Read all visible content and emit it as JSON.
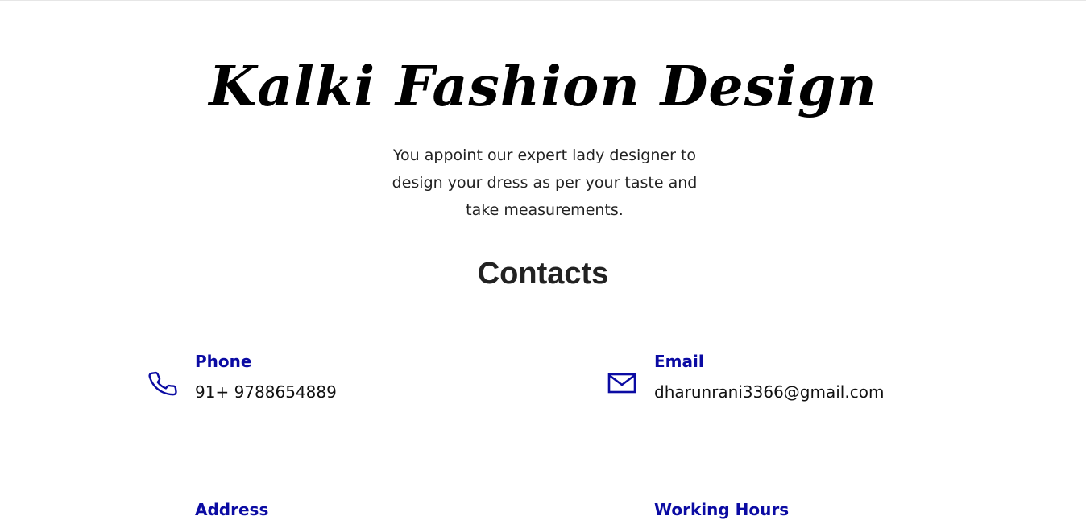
{
  "brand": {
    "title": "Kalki Fashion Design",
    "tagline": "You appoint our expert lady designer to design your dress as per your taste and take measurements."
  },
  "contacts": {
    "heading": "Contacts",
    "phone": {
      "label": "Phone",
      "value": "91+ 9788654889",
      "icon": "phone-icon"
    },
    "email": {
      "label": "Email",
      "value": "dharunrani3366@gmail.com",
      "icon": "envelope-icon"
    },
    "address": {
      "label": "Address"
    },
    "hours": {
      "label": "Working Hours"
    }
  },
  "colors": {
    "accent": "#0b0ba3",
    "text": "#111111",
    "background": "#ffffff"
  }
}
